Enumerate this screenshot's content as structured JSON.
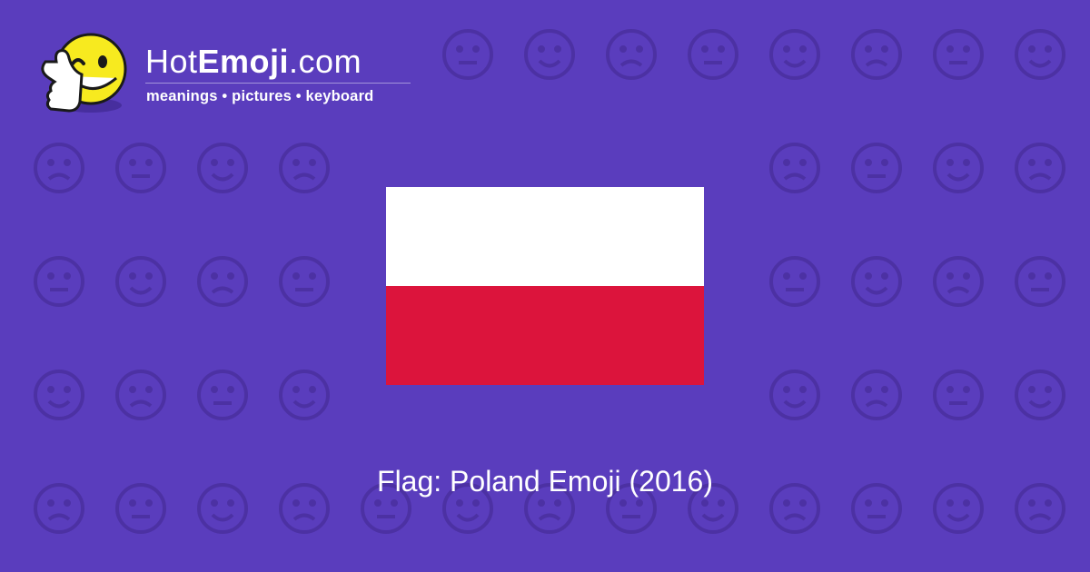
{
  "logo": {
    "brand_part1": "Hot",
    "brand_part2": "Emoji",
    "brand_part3": ".com",
    "tagline": "meanings • pictures • keyboard",
    "icon": "thumbs-up-winking-smiley-icon"
  },
  "emoji": {
    "caption": "Flag: Poland Emoji (2016)",
    "icon": "flag-poland-icon",
    "colors": {
      "top": "#ffffff",
      "bottom": "#dc143c"
    }
  },
  "theme": {
    "background": "#5a3dbd",
    "pattern": "#4a2f9f"
  }
}
